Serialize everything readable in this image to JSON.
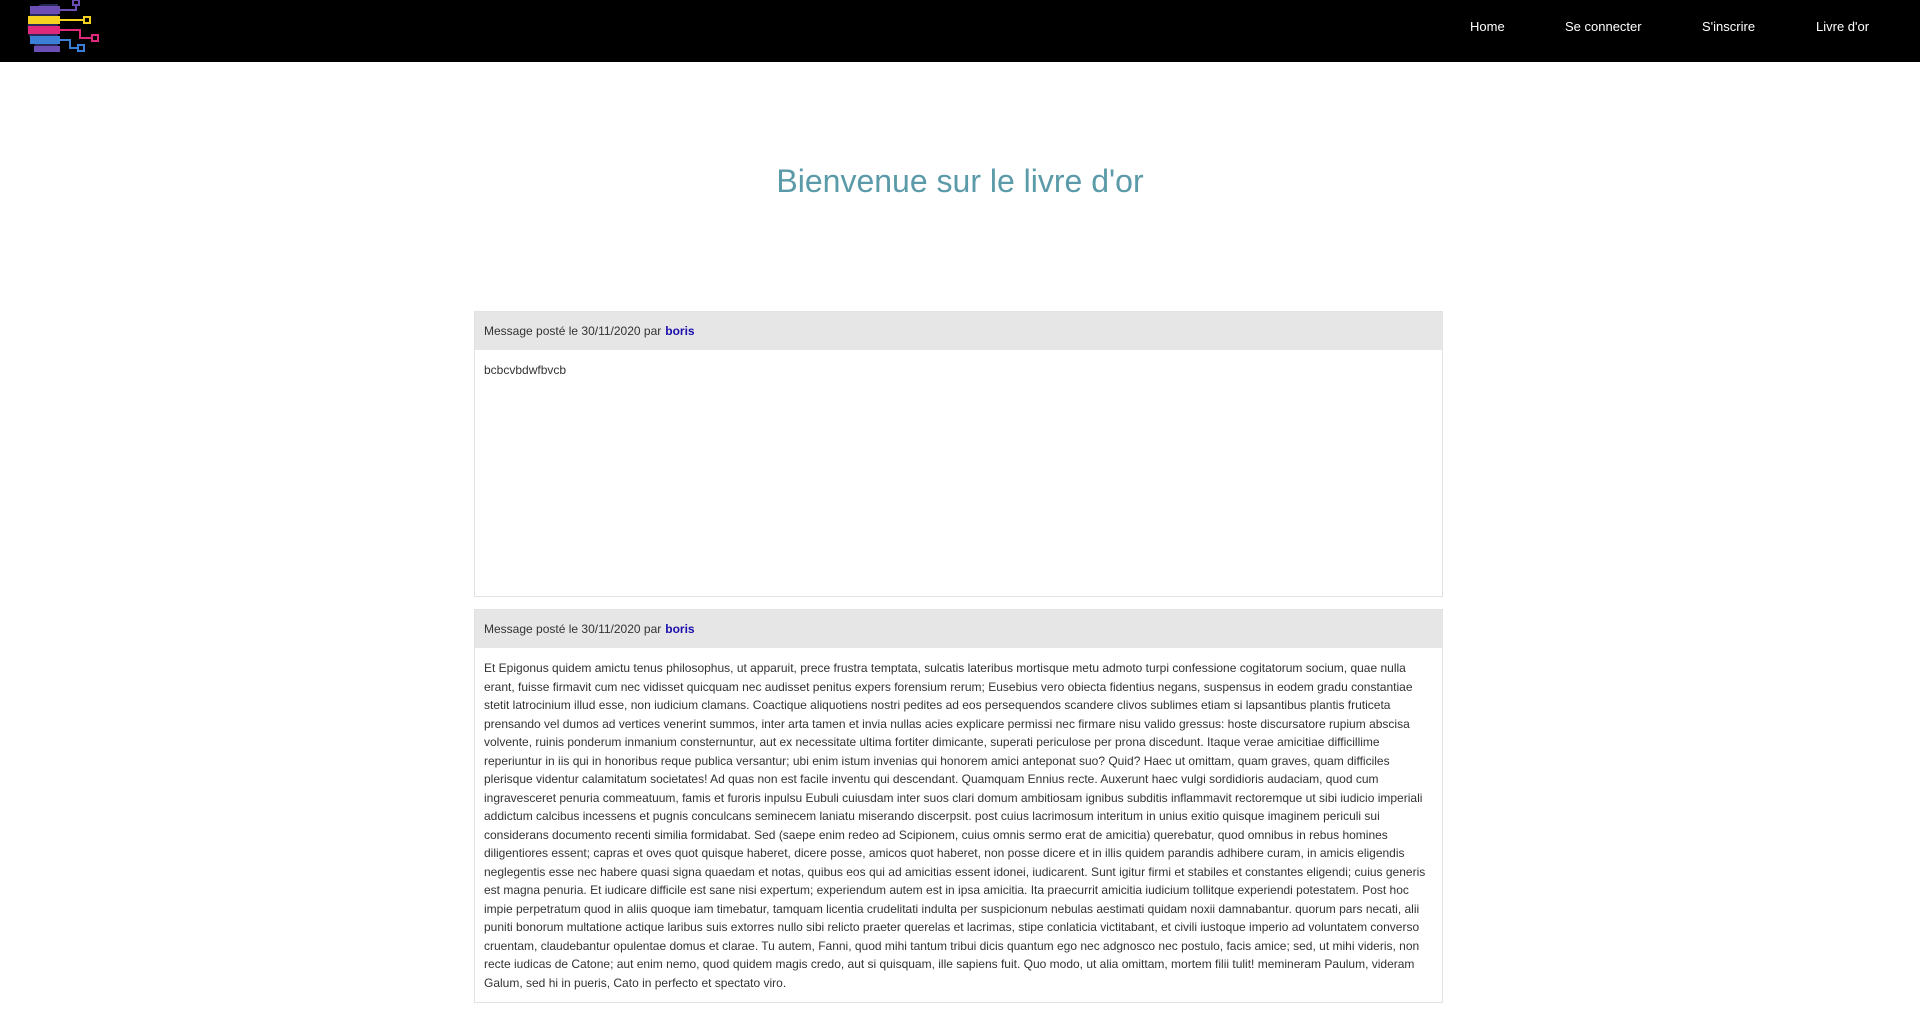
{
  "navbar": {
    "logo_icon": "ai-head-circuit-logo",
    "links": [
      {
        "label": "Home"
      },
      {
        "label": "Se connecter"
      },
      {
        "label": "S'inscrire"
      },
      {
        "label": "Livre d'or"
      }
    ]
  },
  "page": {
    "title": "Bienvenue sur le livre d'or"
  },
  "messages": [
    {
      "prefix": "Message posté le 30/11/2020 par",
      "author": "boris",
      "body": "bcbcvbdwfbvcb"
    },
    {
      "prefix": "Message posté le 30/11/2020 par",
      "author": "boris",
      "body": "Et Epigonus quidem amictu tenus philosophus, ut apparuit, prece frustra temptata, sulcatis lateribus mortisque metu admoto turpi confessione cogitatorum socium, quae nulla erant, fuisse firmavit cum nec vidisset quicquam nec audisset penitus expers forensium rerum; Eusebius vero obiecta fidentius negans, suspensus in eodem gradu constantiae stetit latrocinium illud esse, non iudicium clamans. Coactique aliquotiens nostri pedites ad eos persequendos scandere clivos sublimes etiam si lapsantibus plantis fruticeta prensando vel dumos ad vertices venerint summos, inter arta tamen et invia nullas acies explicare permissi nec firmare nisu valido gressus: hoste discursatore rupium abscisa volvente, ruinis ponderum inmanium consternuntur, aut ex necessitate ultima fortiter dimicante, superati periculose per prona discedunt. Itaque verae amicitiae difficillime reperiuntur in iis qui in honoribus reque publica versantur; ubi enim istum invenias qui honorem amici anteponat suo? Quid? Haec ut omittam, quam graves, quam difficiles plerisque videntur calamitatum societates! Ad quas non est facile inventu qui descendant. Quamquam Ennius recte. Auxerunt haec vulgi sordidioris audaciam, quod cum ingravesceret penuria commeatuum, famis et furoris inpulsu Eubuli cuiusdam inter suos clari domum ambitiosam ignibus subditis inflammavit rectoremque ut sibi iudicio imperiali addictum calcibus incessens et pugnis conculcans seminecem laniatu miserando discerpsit. post cuius lacrimosum interitum in unius exitio quisque imaginem periculi sui considerans documento recenti similia formidabat. Sed (saepe enim redeo ad Scipionem, cuius omnis sermo erat de amicitia) querebatur, quod omnibus in rebus homines diligentiores essent; capras et oves quot quisque haberet, dicere posse, amicos quot haberet, non posse dicere et in illis quidem parandis adhibere curam, in amicis eligendis neglegentis esse nec habere quasi signa quaedam et notas, quibus eos qui ad amicitias essent idonei, iudicarent. Sunt igitur firmi et stabiles et constantes eligendi; cuius generis est magna penuria. Et iudicare difficile est sane nisi expertum; experiendum autem est in ipsa amicitia. Ita praecurrit amicitia iudicium tollitque experiendi potestatem. Post hoc impie perpetratum quod in aliis quoque iam timebatur, tamquam licentia crudelitati indulta per suspicionum nebulas aestimati quidam noxii damnabantur. quorum pars necati, alii puniti bonorum multatione actique laribus suis extorres nullo sibi relicto praeter querelas et lacrimas, stipe conlaticia victitabant, et civili iustoque imperio ad voluntatem converso cruentam, claudebantur opulentae domus et clarae. Tu autem, Fanni, quod mihi tantum tribui dicis quantum ego nec adgnosco nec postulo, facis amice; sed, ut mihi videris, non recte iudicas de Catone; aut enim nemo, quod quidem magis credo, aut si quisquam, ille sapiens fuit. Quo modo, ut alia omittam, mortem filii tulit! memineram Paulum, videram Galum, sed hi in pueris, Cato in perfecto et spectato viro."
    }
  ]
}
